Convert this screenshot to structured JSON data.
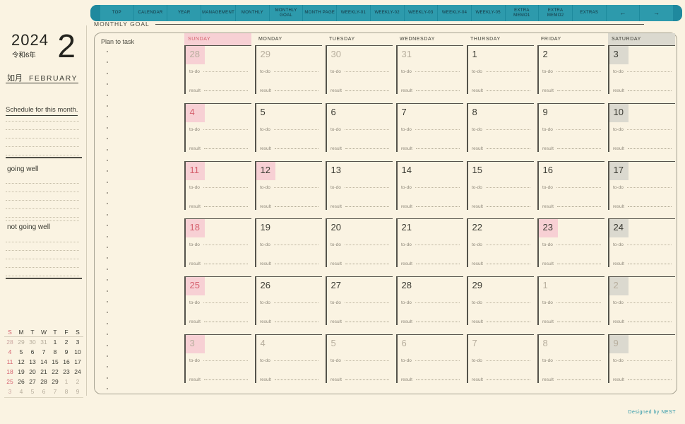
{
  "nav": {
    "tabs": [
      "TOP",
      "CALENDAR",
      "YEAR",
      "MANAGEMENT",
      "MONTHLY",
      "MONTHLY GOAL",
      "MONTH PAGE",
      "WEEKLY-01",
      "WEEKLY-02",
      "WEEKLY-03",
      "WEEKLY-04",
      "WEEKLY-05",
      "EXTRA MEMO1",
      "EXTRA MEMO2",
      "EXTRAS"
    ],
    "arrow_left": "←",
    "arrow_right": "→"
  },
  "header": {
    "title": "MONTHLY GOAL"
  },
  "sidebar": {
    "year": "2024",
    "era": "令和6年",
    "month_number": "2",
    "month_jp": "如月",
    "month_en": "FEBRUARY",
    "schedule_label": "Schedule for this month.",
    "going_well_label": "going well",
    "not_going_well_label": "not going well",
    "mini_calendar": {
      "weekday_headers": [
        "S",
        "M",
        "T",
        "W",
        "T",
        "F",
        "S"
      ],
      "header_colors": [
        "red",
        "dark",
        "dark",
        "dark",
        "dark",
        "dark",
        "dark"
      ],
      "rows": [
        [
          {
            "d": "28",
            "c": "mutedsun"
          },
          {
            "d": "29",
            "c": "muted"
          },
          {
            "d": "30",
            "c": "muted"
          },
          {
            "d": "31",
            "c": "muted"
          },
          {
            "d": "1",
            "c": "dark"
          },
          {
            "d": "2",
            "c": "dark"
          },
          {
            "d": "3",
            "c": "dark"
          }
        ],
        [
          {
            "d": "4",
            "c": "red"
          },
          {
            "d": "5",
            "c": "dark"
          },
          {
            "d": "6",
            "c": "dark"
          },
          {
            "d": "7",
            "c": "dark"
          },
          {
            "d": "8",
            "c": "dark"
          },
          {
            "d": "9",
            "c": "dark"
          },
          {
            "d": "10",
            "c": "dark"
          }
        ],
        [
          {
            "d": "11",
            "c": "red"
          },
          {
            "d": "12",
            "c": "dark"
          },
          {
            "d": "13",
            "c": "dark"
          },
          {
            "d": "14",
            "c": "dark"
          },
          {
            "d": "15",
            "c": "dark"
          },
          {
            "d": "16",
            "c": "dark"
          },
          {
            "d": "17",
            "c": "dark"
          }
        ],
        [
          {
            "d": "18",
            "c": "red"
          },
          {
            "d": "19",
            "c": "dark"
          },
          {
            "d": "20",
            "c": "dark"
          },
          {
            "d": "21",
            "c": "dark"
          },
          {
            "d": "22",
            "c": "dark"
          },
          {
            "d": "23",
            "c": "dark"
          },
          {
            "d": "24",
            "c": "dark"
          }
        ],
        [
          {
            "d": "25",
            "c": "red"
          },
          {
            "d": "26",
            "c": "dark"
          },
          {
            "d": "27",
            "c": "dark"
          },
          {
            "d": "28",
            "c": "dark"
          },
          {
            "d": "29",
            "c": "dark"
          },
          {
            "d": "1",
            "c": "muted"
          },
          {
            "d": "2",
            "c": "muted"
          }
        ],
        [
          {
            "d": "3",
            "c": "mutedsun"
          },
          {
            "d": "4",
            "c": "muted"
          },
          {
            "d": "5",
            "c": "muted"
          },
          {
            "d": "6",
            "c": "muted"
          },
          {
            "d": "7",
            "c": "muted"
          },
          {
            "d": "8",
            "c": "muted"
          },
          {
            "d": "9",
            "c": "muted"
          }
        ]
      ]
    }
  },
  "main": {
    "plan_label": "Plan to task",
    "todo_label": "to-do",
    "result_label": "result",
    "day_headers": [
      {
        "label": "SUNDAY",
        "style": "sun"
      },
      {
        "label": "MONDAY",
        "style": "none"
      },
      {
        "label": "TUESDAY",
        "style": "none"
      },
      {
        "label": "WEDNESDAY",
        "style": "none"
      },
      {
        "label": "THURSDAY",
        "style": "none"
      },
      {
        "label": "FRIDAY",
        "style": "none"
      },
      {
        "label": "SATURDAY",
        "style": "sat"
      }
    ],
    "weeks": [
      [
        {
          "d": "28",
          "c": "muted",
          "bg": "pink"
        },
        {
          "d": "29",
          "c": "muted",
          "bg": "none"
        },
        {
          "d": "30",
          "c": "muted",
          "bg": "none"
        },
        {
          "d": "31",
          "c": "muted",
          "bg": "none"
        },
        {
          "d": "1",
          "c": "dark",
          "bg": "none"
        },
        {
          "d": "2",
          "c": "dark",
          "bg": "none"
        },
        {
          "d": "3",
          "c": "dark",
          "bg": "gray"
        }
      ],
      [
        {
          "d": "4",
          "c": "red",
          "bg": "pink"
        },
        {
          "d": "5",
          "c": "dark",
          "bg": "none"
        },
        {
          "d": "6",
          "c": "dark",
          "bg": "none"
        },
        {
          "d": "7",
          "c": "dark",
          "bg": "none"
        },
        {
          "d": "8",
          "c": "dark",
          "bg": "none"
        },
        {
          "d": "9",
          "c": "dark",
          "bg": "none"
        },
        {
          "d": "10",
          "c": "dark",
          "bg": "gray"
        }
      ],
      [
        {
          "d": "11",
          "c": "red",
          "bg": "pink"
        },
        {
          "d": "12",
          "c": "dark",
          "bg": "pink"
        },
        {
          "d": "13",
          "c": "dark",
          "bg": "none"
        },
        {
          "d": "14",
          "c": "dark",
          "bg": "none"
        },
        {
          "d": "15",
          "c": "dark",
          "bg": "none"
        },
        {
          "d": "16",
          "c": "dark",
          "bg": "none"
        },
        {
          "d": "17",
          "c": "dark",
          "bg": "gray"
        }
      ],
      [
        {
          "d": "18",
          "c": "red",
          "bg": "pink"
        },
        {
          "d": "19",
          "c": "dark",
          "bg": "none"
        },
        {
          "d": "20",
          "c": "dark",
          "bg": "none"
        },
        {
          "d": "21",
          "c": "dark",
          "bg": "none"
        },
        {
          "d": "22",
          "c": "dark",
          "bg": "none"
        },
        {
          "d": "23",
          "c": "dark",
          "bg": "pink"
        },
        {
          "d": "24",
          "c": "dark",
          "bg": "gray"
        }
      ],
      [
        {
          "d": "25",
          "c": "red",
          "bg": "pink"
        },
        {
          "d": "26",
          "c": "dark",
          "bg": "none"
        },
        {
          "d": "27",
          "c": "dark",
          "bg": "none"
        },
        {
          "d": "28",
          "c": "dark",
          "bg": "none"
        },
        {
          "d": "29",
          "c": "dark",
          "bg": "none"
        },
        {
          "d": "1",
          "c": "muted",
          "bg": "none"
        },
        {
          "d": "2",
          "c": "muted",
          "bg": "gray"
        }
      ],
      [
        {
          "d": "3",
          "c": "muted",
          "bg": "pink"
        },
        {
          "d": "4",
          "c": "muted",
          "bg": "none"
        },
        {
          "d": "5",
          "c": "muted",
          "bg": "none"
        },
        {
          "d": "6",
          "c": "muted",
          "bg": "none"
        },
        {
          "d": "7",
          "c": "muted",
          "bg": "none"
        },
        {
          "d": "8",
          "c": "muted",
          "bg": "none"
        },
        {
          "d": "9",
          "c": "muted",
          "bg": "gray"
        }
      ]
    ]
  },
  "footer": {
    "credit": "Designed by NEST"
  },
  "colors": {
    "background": "#faf3e2",
    "nav_teal": "#2d9aac",
    "holiday_pink": "#f7d0d4",
    "saturday_gray": "#dbd9cf",
    "sunday_red": "#d5626f",
    "grid_line": "#55534b"
  }
}
